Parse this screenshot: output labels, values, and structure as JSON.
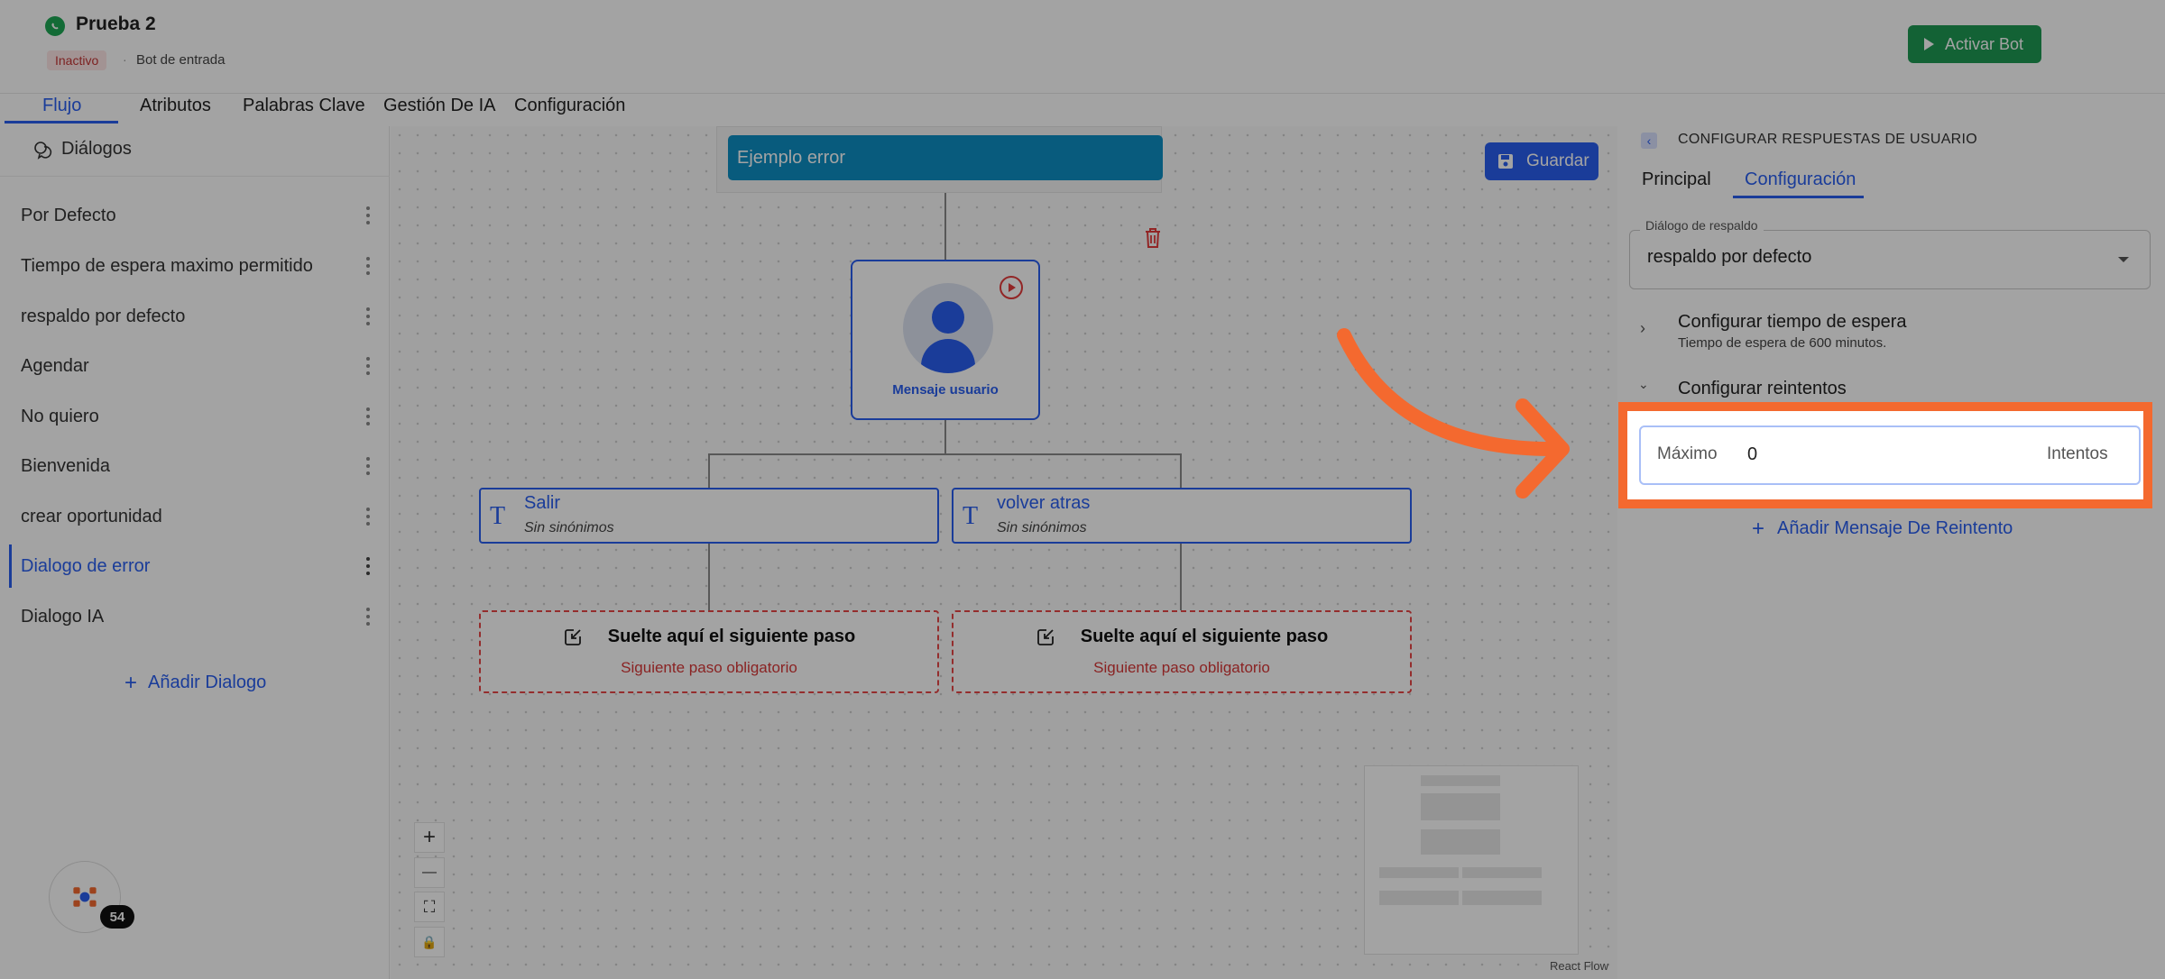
{
  "header": {
    "bot_name": "Prueba 2",
    "status": "Inactivo",
    "separator": "·",
    "bot_type": "Bot de entrada",
    "activate_label": "Activar Bot"
  },
  "tabs": [
    "Flujo",
    "Atributos",
    "Palabras Clave",
    "Gestión De IA",
    "Configuración"
  ],
  "sidebar": {
    "title": "Diálogos",
    "items": [
      {
        "label": "Por Defecto"
      },
      {
        "label": "Tiempo de espera maximo permitido"
      },
      {
        "label": "respaldo por defecto"
      },
      {
        "label": "Agendar"
      },
      {
        "label": "No quiero"
      },
      {
        "label": "Bienvenida"
      },
      {
        "label": "crear oportunidad"
      },
      {
        "label": "Dialogo de error"
      },
      {
        "label": "Dialogo IA"
      }
    ],
    "active_item": "Dialogo de error",
    "add_label": "Añadir Dialogo"
  },
  "canvas": {
    "save_label": "Guardar",
    "title_node": "Ejemplo error",
    "user_node_label": "Mensaje usuario",
    "keyword_nodes": [
      {
        "label": "Salir",
        "sub": "Sin sinónimos"
      },
      {
        "label": "volver atras",
        "sub": "Sin sinónimos"
      }
    ],
    "drop_nodes": [
      {
        "title": "Suelte aquí el siguiente paso",
        "sub": "Siguiente paso obligatorio"
      },
      {
        "title": "Suelte aquí el siguiente paso",
        "sub": "Siguiente paso obligatorio"
      }
    ],
    "zoom_controls": [
      "+",
      "—",
      "⛶",
      "🔒"
    ],
    "attribution": "React Flow",
    "notification_count": "54"
  },
  "panel": {
    "title": "CONFIGURAR RESPUESTAS DE USUARIO",
    "tabs": [
      "Principal",
      "Configuración"
    ],
    "active_tab": "Configuración",
    "fallback_legend": "Diálogo de respaldo",
    "fallback_value": "respaldo por defecto",
    "timeout_title": "Configurar tiempo de espera",
    "timeout_sub": "Tiempo de espera de 600 minutos.",
    "retries_title": "Configurar reintentos",
    "retry_label": "Máximo",
    "retry_value": "0",
    "retry_unit": "Intentos",
    "add_retry_label": "Añadir Mensaje De Reintento"
  },
  "colors": {
    "accent": "#2a5ff0",
    "success": "#1e9954",
    "danger": "#e84747",
    "title_node": "#0d8fc4",
    "highlight": "#f4692f"
  }
}
